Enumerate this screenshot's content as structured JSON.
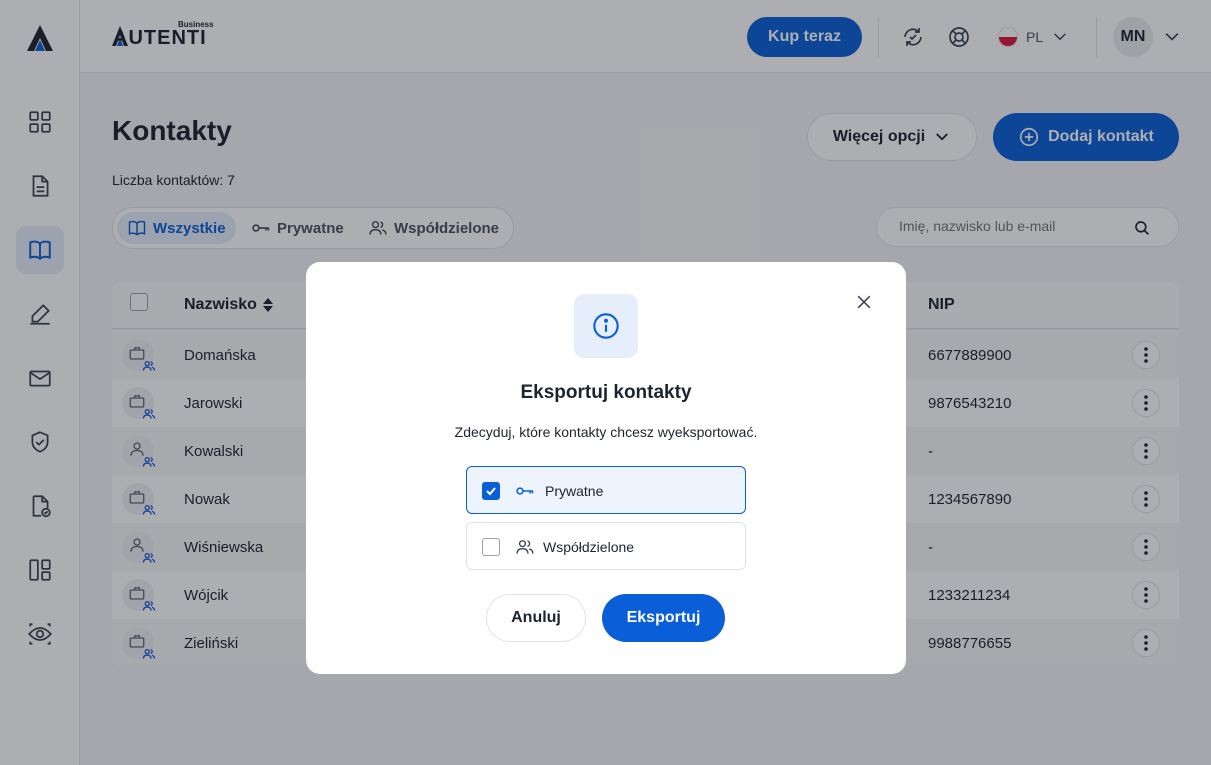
{
  "header": {
    "brand_name": "AUTENTI",
    "brand_sub": "Business",
    "buy_label": "Kup teraz",
    "language": "PL",
    "user_initials": "MN"
  },
  "sidebar": {
    "items": [
      {
        "icon": "dashboard-icon"
      },
      {
        "icon": "document-icon"
      },
      {
        "icon": "contacts-book-icon",
        "active": true
      },
      {
        "icon": "signature-pen-icon"
      },
      {
        "icon": "envelope-icon"
      },
      {
        "icon": "verified-badge-icon"
      },
      {
        "icon": "document-check-icon"
      },
      {
        "icon": "templates-icon"
      },
      {
        "icon": "eye-icon"
      }
    ]
  },
  "page": {
    "title": "Kontakty",
    "count_label": "Liczba kontaktów: 7",
    "more_options_label": "Więcej opcji",
    "add_contact_label": "Dodaj kontakt",
    "tabs": [
      {
        "label": "Wszystkie",
        "active": true
      },
      {
        "label": "Prywatne"
      },
      {
        "label": "Współdzielone"
      }
    ],
    "search_placeholder": "Imię, nazwisko lub e-mail"
  },
  "table": {
    "columns": [
      "Nazwisko",
      "NIP"
    ],
    "rows": [
      {
        "type": "company",
        "name": "Domańska",
        "nip": "6677889900"
      },
      {
        "type": "company",
        "name": "Jarowski",
        "nip": "9876543210"
      },
      {
        "type": "person",
        "name": "Kowalski",
        "nip": "-"
      },
      {
        "type": "company",
        "name": "Nowak",
        "nip": "1234567890"
      },
      {
        "type": "person",
        "name": "Wiśniewska",
        "nip": "-"
      },
      {
        "type": "company",
        "name": "Wójcik",
        "nip": "1233211234"
      },
      {
        "type": "company",
        "name": "Zieliński",
        "nip": "9988776655"
      }
    ]
  },
  "modal": {
    "title": "Eksportuj kontakty",
    "description": "Zdecyduj, które kontakty chcesz wyeksportować.",
    "options": [
      {
        "label": "Prywatne",
        "checked": true
      },
      {
        "label": "Współdzielone",
        "checked": false
      }
    ],
    "cancel_label": "Anuluj",
    "export_label": "Eksportuj"
  },
  "colors": {
    "primary": "#0a5ed7",
    "text": "#1d2330",
    "active_bg": "#e6eefb"
  }
}
